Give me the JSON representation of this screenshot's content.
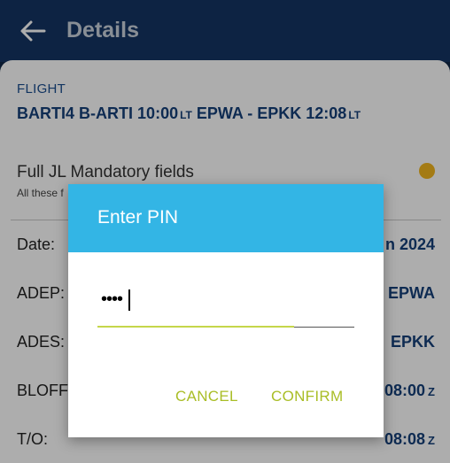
{
  "appbar": {
    "title": "Details",
    "back_icon": "arrow-left-icon"
  },
  "flight": {
    "section_label": "FLIGHT",
    "callsign": "BARTI4",
    "registration": "B-ARTI",
    "dep_time": "10:00",
    "dep_tz": "LT",
    "route": "EPWA - EPKK",
    "arr_time": "12:08",
    "arr_tz": "LT"
  },
  "mandatory": {
    "title": "Full JL Mandatory fields",
    "subtitle": "All these f",
    "status_color": "#f2b51e"
  },
  "rows": [
    {
      "label": "Date:",
      "value": "n 2024",
      "tz": ""
    },
    {
      "label": "ADEP:",
      "value": "EPWA",
      "tz": ""
    },
    {
      "label": "ADES:",
      "value": "EPKK",
      "tz": ""
    },
    {
      "label": "BLOFF",
      "value": "08:00",
      "tz": "Z"
    },
    {
      "label": "T/O:",
      "value": "08:08",
      "tz": "Z"
    }
  ],
  "dialog": {
    "title": "Enter PIN",
    "pin_masked": "••••",
    "cancel_label": "CANCEL",
    "confirm_label": "CONFIRM",
    "header_color": "#33b5e5",
    "accent_color": "#a9bd25"
  }
}
